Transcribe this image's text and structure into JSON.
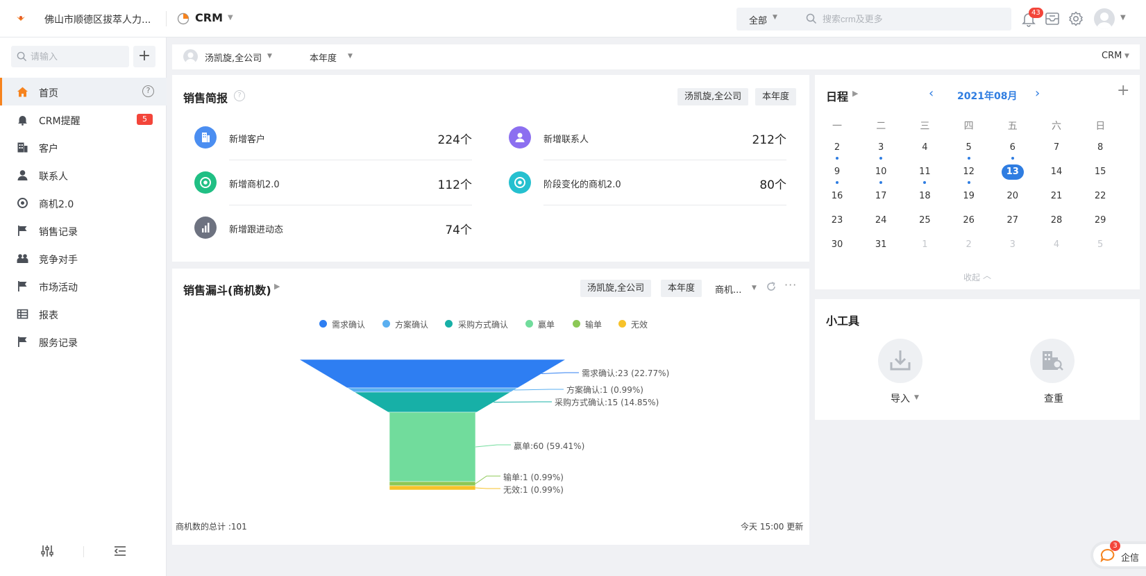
{
  "topbar": {
    "company": "佛山市顺德区拔萃人力...",
    "app_name": "CRM",
    "scope": "全部",
    "search_placeholder": "搜索crm及更多",
    "notification_count": "43"
  },
  "sidebar": {
    "search_placeholder": "请输入",
    "add": "+",
    "help": "?",
    "items": [
      {
        "label": "首页",
        "icon": "home-icon"
      },
      {
        "label": "CRM提醒",
        "icon": "bell-icon",
        "badge": "5"
      },
      {
        "label": "客户",
        "icon": "building-icon"
      },
      {
        "label": "联系人",
        "icon": "person-icon"
      },
      {
        "label": "商机2.0",
        "icon": "target-icon"
      },
      {
        "label": "销售记录",
        "icon": "flag-icon"
      },
      {
        "label": "竞争对手",
        "icon": "people-icon"
      },
      {
        "label": "市场活动",
        "icon": "flag-icon"
      },
      {
        "label": "报表",
        "icon": "table-icon"
      },
      {
        "label": "服务记录",
        "icon": "flag-icon"
      }
    ]
  },
  "filterbar": {
    "user": "汤凯旋,全公司",
    "period": "本年度",
    "crm": "CRM"
  },
  "sales_brief": {
    "title": "销售简报",
    "tag_user": "汤凯旋,全公司",
    "tag_period": "本年度",
    "kpis": [
      {
        "label": "新增客户",
        "value": "224个",
        "color": "#4b8ef1"
      },
      {
        "label": "新增联系人",
        "value": "212个",
        "color": "#8c6ff0"
      },
      {
        "label": "新增商机2.0",
        "value": "112个",
        "color": "#20bf84"
      },
      {
        "label": "阶段变化的商机2.0",
        "value": "80个",
        "color": "#25c0cf"
      },
      {
        "label": "新增跟进动态",
        "value": "74个",
        "color": "#6d7280"
      }
    ]
  },
  "funnel": {
    "title": "销售漏斗(商机数)",
    "tag_user": "汤凯旋,全公司",
    "tag_period": "本年度",
    "tag_metric": "商机...",
    "total": "商机数的总计 :101",
    "updated": "今天 15:00 更新"
  },
  "chart_data": {
    "type": "funnel",
    "total": 101,
    "series": [
      {
        "name": "需求确认",
        "value": 23,
        "percent": "22.77%",
        "color": "#2e7ef2",
        "label": "需求确认:23 (22.77%)"
      },
      {
        "name": "方案确认",
        "value": 1,
        "percent": "0.99%",
        "color": "#5aaff0",
        "label": "方案确认:1 (0.99%)"
      },
      {
        "name": "采购方式确认",
        "value": 15,
        "percent": "14.85%",
        "color": "#17b0a7",
        "label": "采购方式确认:15 (14.85%)"
      },
      {
        "name": "赢单",
        "value": 60,
        "percent": "59.41%",
        "color": "#71dc9c",
        "label": "赢单:60 (59.41%)"
      },
      {
        "name": "输单",
        "value": 1,
        "percent": "0.99%",
        "color": "#8cc856",
        "label": "输单:1 (0.99%)"
      },
      {
        "name": "无效",
        "value": 1,
        "percent": "0.99%",
        "color": "#f7c22a",
        "label": "无效:1 (0.99%)"
      }
    ]
  },
  "calendar": {
    "title": "日程",
    "month": "2021年08月",
    "weekdays": [
      "一",
      "二",
      "三",
      "四",
      "五",
      "六",
      "日"
    ],
    "collapse": "收起",
    "today": "13",
    "weeks": [
      [
        "2",
        "3",
        "4",
        "5",
        "6",
        "7",
        "8"
      ],
      [
        "9",
        "10",
        "11",
        "12",
        "13",
        "14",
        "15"
      ],
      [
        "16",
        "17",
        "18",
        "19",
        "20",
        "21",
        "22"
      ],
      [
        "23",
        "24",
        "25",
        "26",
        "27",
        "28",
        "29"
      ],
      [
        "30",
        "31",
        "1",
        "2",
        "3",
        "4",
        "5"
      ]
    ],
    "dots": [
      "2",
      "3",
      "5",
      "6",
      "9",
      "10",
      "11",
      "12"
    ]
  },
  "tools": {
    "title": "小工具",
    "import": "导入",
    "dedupe": "查重"
  },
  "qixin": {
    "label": "企信",
    "badge": "3"
  }
}
